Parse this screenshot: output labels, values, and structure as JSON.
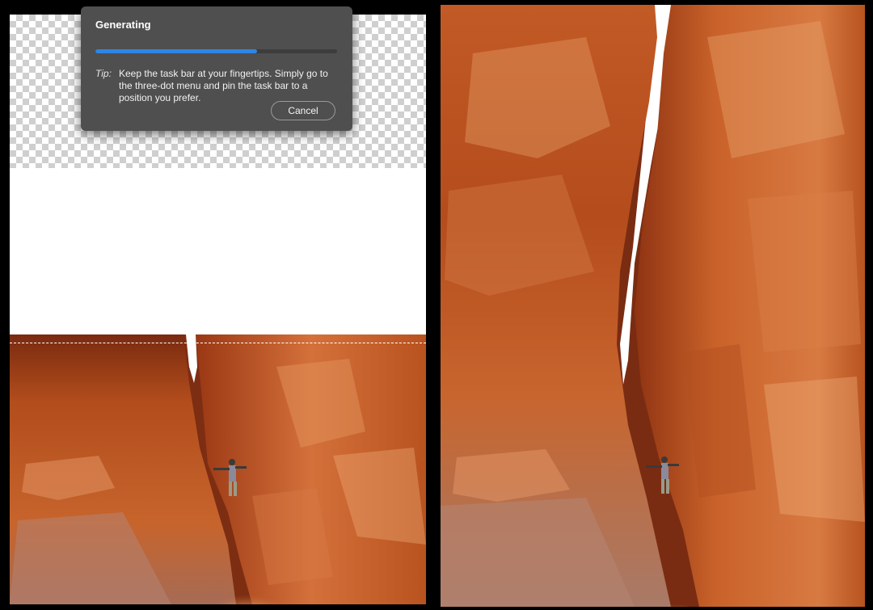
{
  "dialog": {
    "title": "Generating",
    "progress_fraction": 0.67,
    "tip_label": "Tip:",
    "tip_text": "Keep the task bar at your fingertips. Simply go to the three-dot menu and pin the task bar to a position you prefer.",
    "cancel_label": "Cancel"
  },
  "colors": {
    "accent": "#2d86e6",
    "dialog_bg": "#4f4f4f",
    "rock_dark": "#8a2f12",
    "rock_mid": "#c0561f",
    "rock_light": "#e08a4f"
  },
  "canvases": {
    "left": "selection-canvas",
    "right": "extended-image-canvas"
  }
}
